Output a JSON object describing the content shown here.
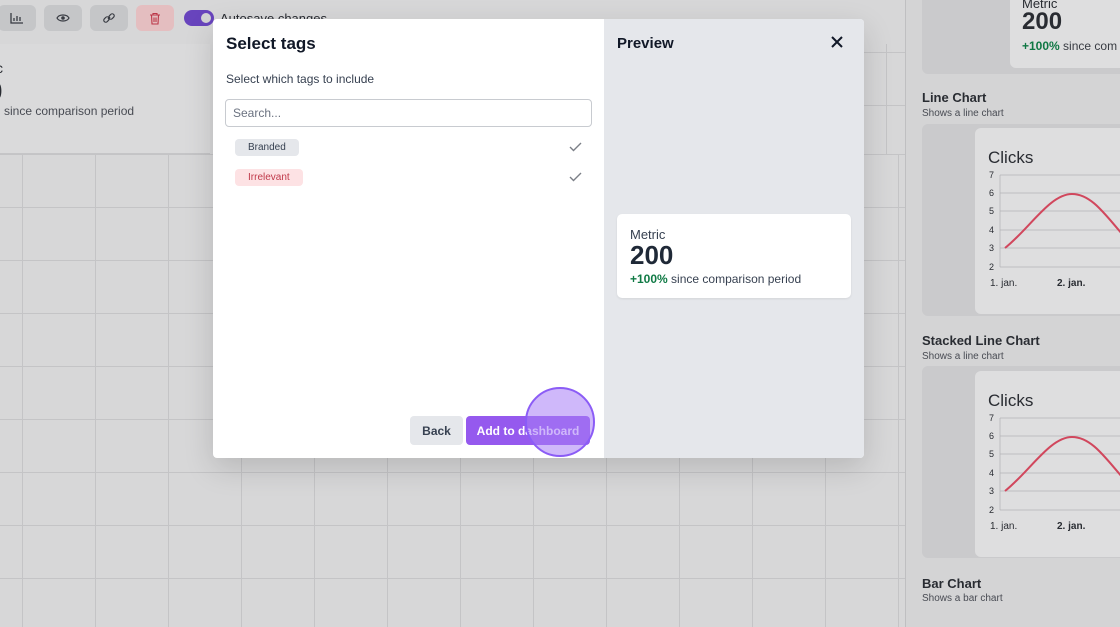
{
  "toolbar": {
    "autosave_label": "Autosave changes",
    "icons": [
      "chart-icon",
      "eye-icon",
      "link-icon",
      "trash-icon"
    ]
  },
  "background_metric": {
    "label": "c",
    "value": "0",
    "since": "since comparison period"
  },
  "right_panel": {
    "metric": {
      "label": "Metric",
      "value": "200",
      "change": "+100%",
      "since": "since com"
    },
    "line_chart": {
      "title": "Line Chart",
      "subtitle": "Shows a line chart",
      "card_title": "Clicks",
      "y_ticks": [
        "7",
        "6",
        "5",
        "4",
        "3",
        "2"
      ],
      "x_ticks": [
        "1. jan.",
        "2. jan."
      ]
    },
    "stacked_line_chart": {
      "title": "Stacked Line Chart",
      "subtitle": "Shows a line chart",
      "card_title": "Clicks",
      "y_ticks": [
        "7",
        "6",
        "5",
        "4",
        "3",
        "2"
      ],
      "x_ticks": [
        "1. jan.",
        "2. jan."
      ]
    },
    "bar_chart": {
      "title": "Bar Chart",
      "subtitle": "Shows a bar chart"
    }
  },
  "modal": {
    "title": "Select tags",
    "description": "Select which tags to include",
    "search": {
      "value": "",
      "placeholder": "Search..."
    },
    "tags": [
      {
        "label": "Branded",
        "selected": true,
        "color": "#e5e7eb"
      },
      {
        "label": "Irrelevant",
        "selected": true,
        "color": "#fde2e4"
      }
    ],
    "back_label": "Back",
    "add_label": "Add to dashboard",
    "accent_color": "#9559ee"
  },
  "preview": {
    "title": "Preview",
    "card": {
      "label": "Metric",
      "value": "200",
      "change": "+100%",
      "since": "since comparison period"
    }
  }
}
